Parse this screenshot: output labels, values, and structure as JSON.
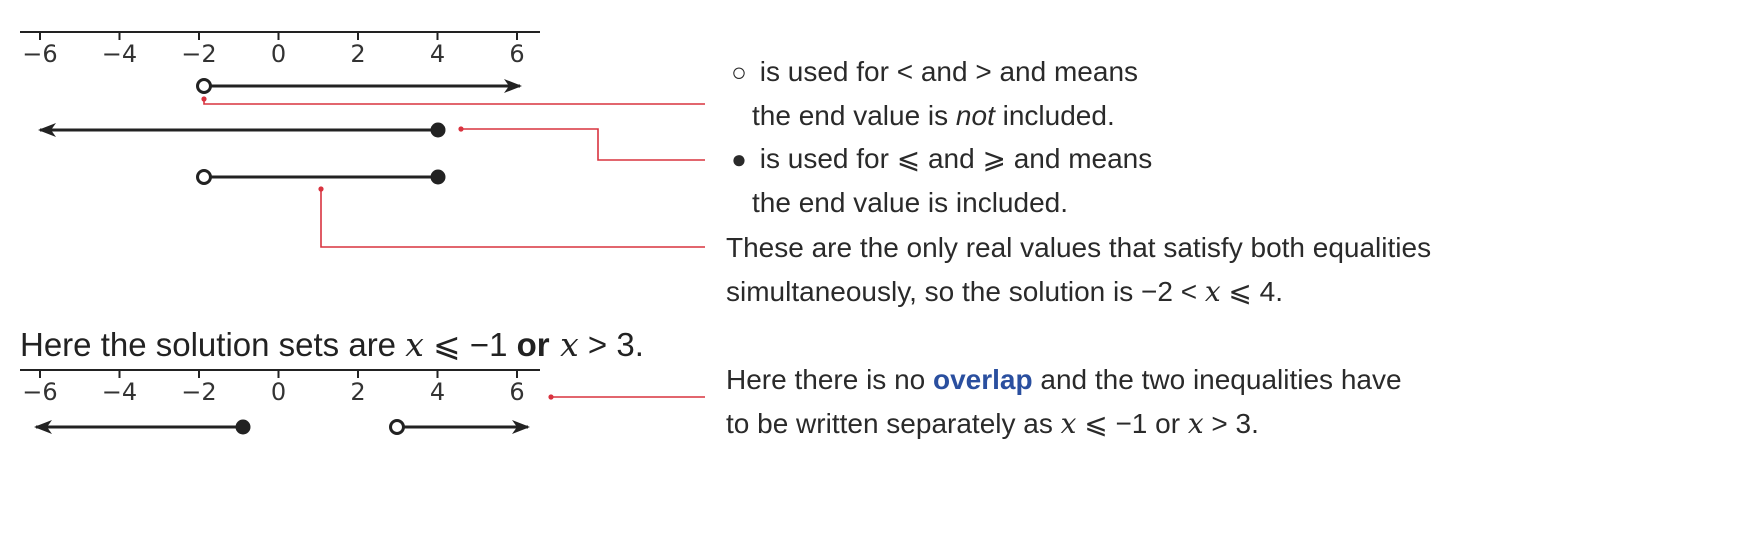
{
  "axis": {
    "tick_labels": [
      "−6",
      "−4",
      "−2",
      "0",
      "2",
      "4",
      "6"
    ]
  },
  "lines_top": [
    {
      "from": "-2",
      "to": "right-arrow",
      "start_marker": "open",
      "end_marker": "arrow"
    },
    {
      "from": "left-arrow",
      "to": "4",
      "start_marker": "arrow",
      "end_marker": "closed"
    },
    {
      "from": "-2",
      "to": "4",
      "start_marker": "open",
      "end_marker": "closed"
    }
  ],
  "lines_bottom": [
    {
      "from": "left-arrow",
      "to": "-1",
      "start_marker": "arrow",
      "end_marker": "closed"
    },
    {
      "from": "3",
      "to": "right-arrow",
      "start_marker": "open",
      "end_marker": "arrow"
    }
  ],
  "notes": {
    "open_circle": {
      "glyph": "○",
      "text_1": " is used for < and > and means",
      "text_2a": "the end value is ",
      "text_2b": "not",
      "text_2c": " included."
    },
    "closed_circle": {
      "glyph": "●",
      "text_1": " is used for ⩽ and ⩾ and means",
      "text_2": "the end value is included."
    },
    "overlap": {
      "line_1": "These are the only real values that satisfy both equalities",
      "line_2a": "simultaneously, so the solution is −2 < ",
      "var": "x",
      "line_2b": " ⩽ 4."
    },
    "no_overlap": {
      "line_1a": "Here there is no ",
      "keyword": "overlap",
      "line_1b": " and the two inequalities have",
      "line_2a": "to be written separately as ",
      "var1": "x",
      "line_2b": " ⩽ −1 or ",
      "var2": "x",
      "line_2c": " > 3."
    }
  },
  "heading": {
    "prefix": "Here the solution sets are ",
    "var1": "x",
    "rel1": " ⩽ −1 ",
    "or": "or",
    "var2": " x",
    "rel2": " > 3."
  },
  "colors": {
    "line": "#222222",
    "leader": "#d9333f",
    "keyword": "#2a4f9f"
  }
}
